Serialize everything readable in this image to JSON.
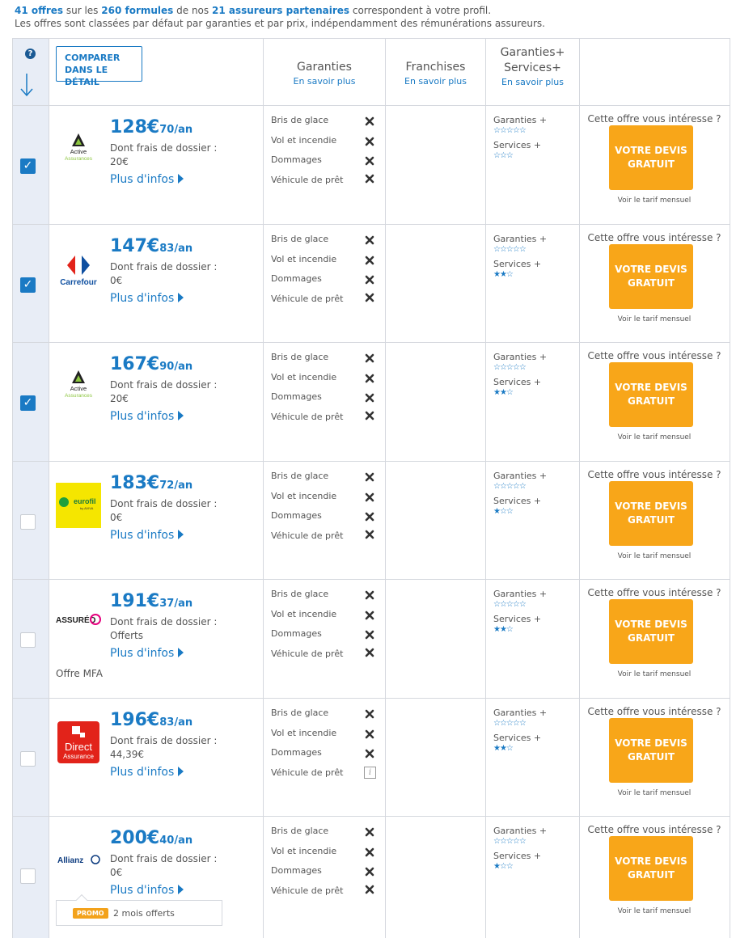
{
  "summary": {
    "count_offers": "41 offres",
    "t1": " sur les ",
    "count_formulas": "260 formules",
    "t2": " de nos ",
    "count_insurers": "21 assureurs partenaires",
    "t3": " correspondent à votre profil.",
    "line2": "Les offres sont classées par défaut par garanties et par prix, indépendamment des rémunérations assureurs."
  },
  "header": {
    "help": "?",
    "compare_line1": "COMPARER",
    "compare_line2": "DANS LE DÉTAIL",
    "garanties": "Garanties",
    "garanties_link": "En savoir plus",
    "franchises": "Franchises",
    "franchises_link": "En savoir plus",
    "gs_line1": "Garanties+",
    "gs_line2": "Services+",
    "gs_link": "En savoir plus"
  },
  "labels": {
    "fees": "Dont frais de dossier :",
    "more": "Plus d'infos",
    "interest": "Cette offre vous intéresse ?",
    "devis1": "VOTRE DEVIS",
    "devis2": "GRATUIT",
    "mensuel": "Voir le tarif mensuel",
    "gplus": "Garanties +",
    "splus": "Services +",
    "g1": "Bris de glace",
    "g2": "Vol et incendie",
    "g3": "Dommages",
    "g4": "Véhicule de prêt",
    "info": "i"
  },
  "colors": {
    "accent": "#1a7ac4",
    "button": "#f8a619",
    "check_col": "#e8edf6"
  },
  "offers": [
    {
      "insurer": "Active Assurances",
      "logo_text1": "Active",
      "logo_text2": "Assurances",
      "checked": true,
      "price_main": "128€",
      "price_cents": "70/an",
      "fees": "20€",
      "stars_g": "☆☆☆☆☆",
      "stars_s": "☆☆☆",
      "vehicle_icon": "cross-icon"
    },
    {
      "insurer": "Carrefour",
      "logo_text1": "Carrefour",
      "checked": true,
      "price_main": "147€",
      "price_cents": "83/an",
      "fees": "0€",
      "stars_g": "☆☆☆☆☆",
      "stars_s": "★★☆",
      "vehicle_icon": "cross-icon"
    },
    {
      "insurer": "Active Assurances",
      "logo_text1": "Active",
      "logo_text2": "Assurances",
      "checked": true,
      "price_main": "167€",
      "price_cents": "90/an",
      "fees": "20€",
      "stars_g": "☆☆☆☆☆",
      "stars_s": "★★☆",
      "vehicle_icon": "cross-icon"
    },
    {
      "insurer": "Eurofil",
      "logo_text1": "eurofil",
      "logo_text2": "by AVIVA",
      "checked": false,
      "price_main": "183€",
      "price_cents": "72/an",
      "fees": "0€",
      "stars_g": "☆☆☆☆☆",
      "stars_s": "★☆☆",
      "vehicle_icon": "cross-icon"
    },
    {
      "insurer": "Assuréo",
      "logo_text1": "ASSURÉO",
      "checked": false,
      "price_main": "191€",
      "price_cents": "37/an",
      "fees": "Offerts",
      "note": "Offre MFA",
      "stars_g": "☆☆☆☆☆",
      "stars_s": "★★☆",
      "vehicle_icon": "cross-icon"
    },
    {
      "insurer": "Direct Assurance",
      "logo_text1": "Direct",
      "logo_text2": "Assurance",
      "checked": false,
      "price_main": "196€",
      "price_cents": "83/an",
      "fees": "44,39€",
      "stars_g": "☆☆☆☆☆",
      "stars_s": "★★☆",
      "vehicle_icon": "info-icon"
    },
    {
      "insurer": "Allianz",
      "logo_text1": "Allianz",
      "checked": false,
      "price_main": "200€",
      "price_cents": "40/an",
      "fees": "0€",
      "stars_g": "☆☆☆☆☆",
      "stars_s": "★☆☆",
      "vehicle_icon": "cross-icon",
      "promo_tag": "PROMO",
      "promo_text": "2 mois offerts"
    }
  ]
}
